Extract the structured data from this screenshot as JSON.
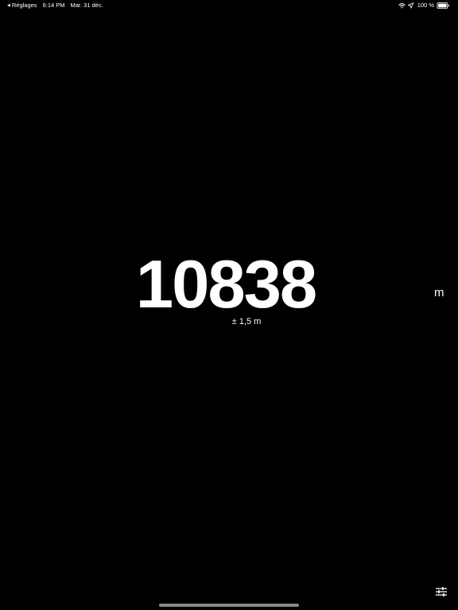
{
  "status_bar": {
    "back_label": "Réglages",
    "time": "6:14 PM",
    "date": "Mar. 31 déc.",
    "battery": "100 %"
  },
  "main": {
    "altitude": "10838",
    "accuracy": "± 1,5 m",
    "unit": "m"
  },
  "colors": {
    "background": "#000000",
    "text": "#ffffff",
    "home_indicator": "#8a8a8a"
  },
  "icons": {
    "back": "back-chevron-icon",
    "wifi": "wifi-icon",
    "location": "location-arrow-icon",
    "battery": "battery-icon",
    "settings": "sliders-icon"
  }
}
